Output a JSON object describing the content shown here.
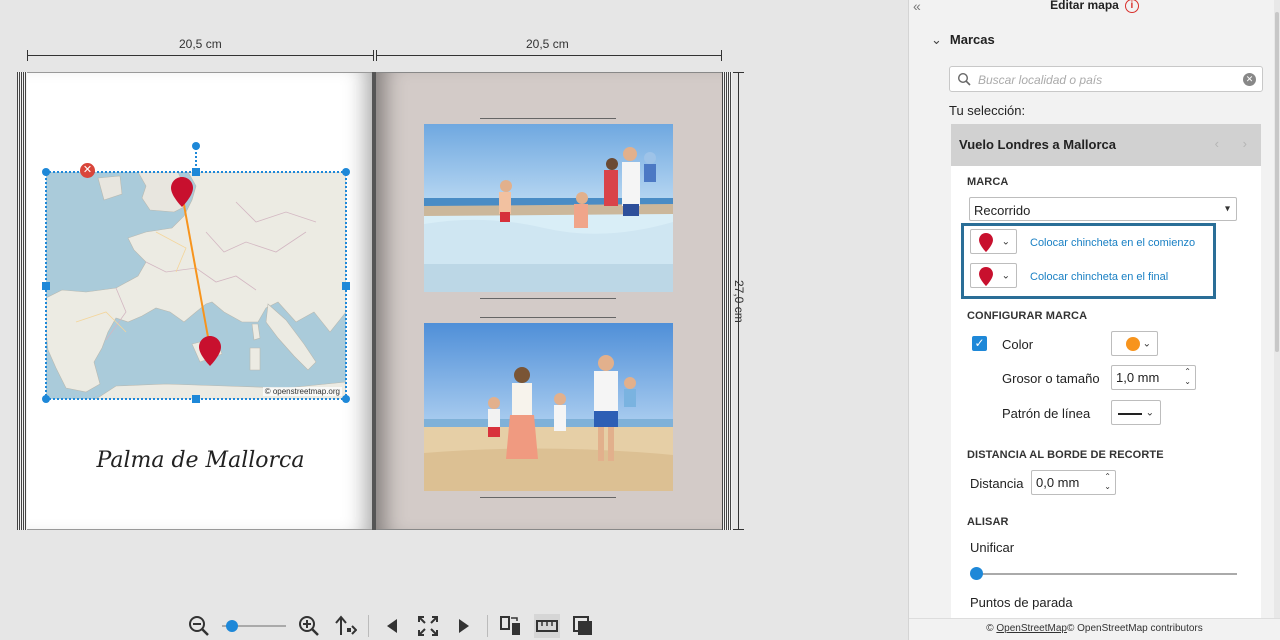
{
  "canvas": {
    "width_label_left": "20,5 cm",
    "width_label_right": "20,5 cm",
    "height_label": "27,0 cm",
    "map_credit": "© openstreetmap.org",
    "caption": "Palma de Mallorca"
  },
  "toolbar": {
    "icons": [
      "zoom-out-icon",
      "zoom-in-icon",
      "export-icon",
      "prev-page-icon",
      "fit-icon",
      "next-page-icon",
      "swap-pages-icon",
      "ruler-icon",
      "layers-icon"
    ]
  },
  "panel": {
    "title": "Editar mapa",
    "section_title": "Marcas",
    "search_placeholder": "Buscar localidad o país",
    "selection_label": "Tu selección:",
    "card_title": "Vuelo Londres a Mallorca",
    "marca": {
      "heading": "MARCA",
      "type_value": "Recorrido",
      "pin_start_link": "Colocar chincheta en el comienzo",
      "pin_end_link": "Colocar chincheta en el final"
    },
    "configurar": {
      "heading": "CONFIGURAR MARCA",
      "color_label": "Color",
      "color_checked": true,
      "color_value": "#f7941d",
      "grosor_label": "Grosor o tamaño",
      "grosor_value": "1,0 mm",
      "patron_label": "Patrón de línea"
    },
    "distancia": {
      "heading": "DISTANCIA AL BORDE DE RECORTE",
      "label": "Distancia",
      "value": "0,0 mm"
    },
    "alisar": {
      "heading": "ALISAR",
      "unificar_label": "Unificar",
      "paradas_label": "Puntos de parada"
    },
    "footer": {
      "prefix": "©",
      "link": "OpenStreetMap",
      "suffix": "© OpenStreetMap contributors"
    }
  },
  "colors": {
    "accent": "#1e88d8",
    "highlight_box": "#2a6e97",
    "pin": "#c8102e",
    "route": "#f7941d"
  }
}
